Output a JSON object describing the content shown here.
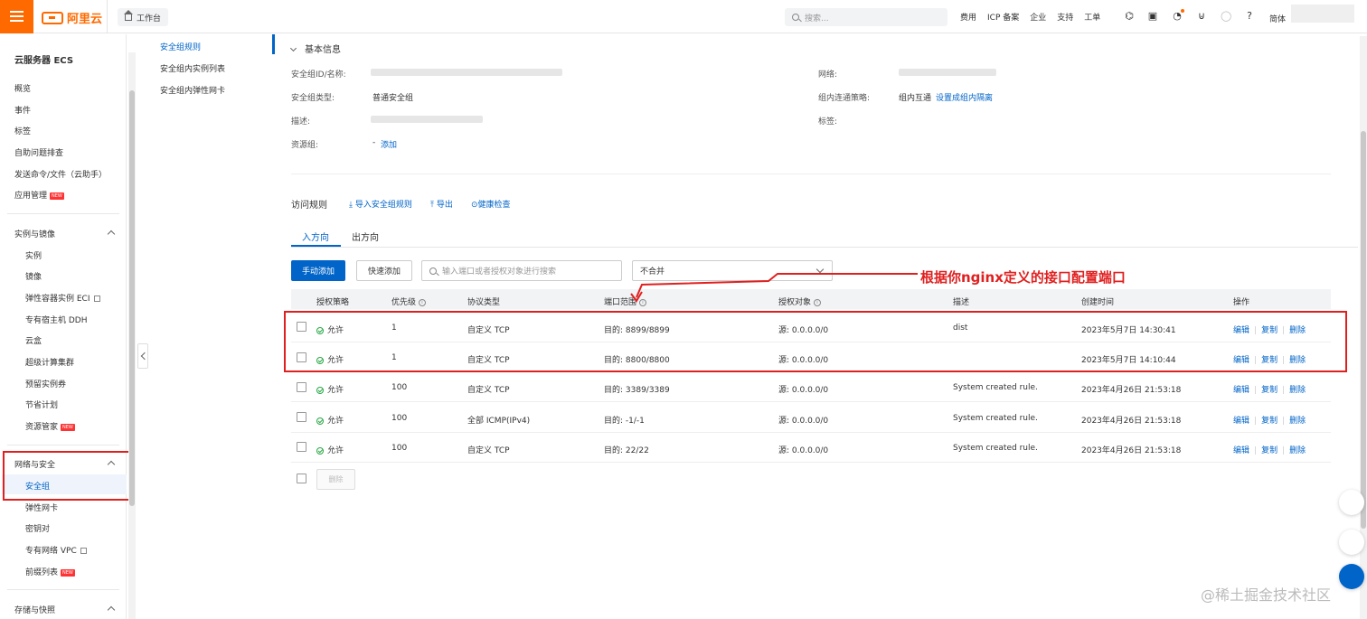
{
  "header": {
    "brand": "阿里云",
    "workbench": "工作台",
    "search_placeholder": "搜索...",
    "links": [
      "费用",
      "ICP 备案",
      "企业",
      "支持",
      "工单"
    ],
    "user": "简体"
  },
  "sidebar": {
    "title": "云服务器 ECS",
    "top_items": [
      "概览",
      "事件",
      "标签",
      "自助问题排查",
      "发送命令/文件（云助手）",
      "应用管理"
    ],
    "new_badge": "NEW",
    "section_instances": "实例与镜像",
    "instance_items": [
      "实例",
      "镜像",
      "弹性容器实例 ECI",
      "专有宿主机 DDH",
      "云盒",
      "超级计算集群",
      "预留实例券",
      "节省计划",
      "资源管家"
    ],
    "section_network": "网络与安全",
    "network_items": [
      "安全组",
      "弹性网卡",
      "密钥对",
      "专有网络 VPC",
      "前缀列表"
    ],
    "section_storage": "存储与快照"
  },
  "subnav": {
    "items": [
      "安全组规则",
      "安全组内实例列表",
      "安全组内弹性网卡"
    ]
  },
  "basic_info": {
    "title": "基本信息",
    "labels": {
      "id_name": "安全组ID/名称:",
      "type": "安全组类型:",
      "desc": "描述:",
      "resource_group": "资源组:",
      "network": "网络:",
      "policy": "组内连通策略:",
      "tags": "标签:"
    },
    "type_value": "普通安全组",
    "resource_group_dash": "-",
    "resource_group_add": "添加",
    "policy_value": "组内互通",
    "policy_link": "设置成组内隔离"
  },
  "rules": {
    "label": "访问规则",
    "import": "导入安全组规则",
    "export": "导出",
    "health": "健康检查",
    "tabs": [
      "入方向",
      "出方向"
    ],
    "add_manual": "手动添加",
    "add_quick": "快速添加",
    "search_placeholder": "输入端口或者授权对象进行搜索",
    "merge_value": "不合并",
    "columns": [
      "授权策略",
      "优先级",
      "协议类型",
      "端口范围",
      "授权对象",
      "描述",
      "创建时间",
      "操作"
    ],
    "rows": [
      {
        "policy": "允许",
        "priority": "1",
        "protocol": "自定义 TCP",
        "port": "目的: 8899/8899",
        "object": "源: 0.0.0.0/0",
        "desc": "dist",
        "time": "2023年5月7日 14:30:41"
      },
      {
        "policy": "允许",
        "priority": "1",
        "protocol": "自定义 TCP",
        "port": "目的: 8800/8800",
        "object": "源: 0.0.0.0/0",
        "desc": "",
        "time": "2023年5月7日 14:10:44"
      },
      {
        "policy": "允许",
        "priority": "100",
        "protocol": "自定义 TCP",
        "port": "目的: 3389/3389",
        "object": "源: 0.0.0.0/0",
        "desc": "System created rule.",
        "time": "2023年4月26日 21:53:18"
      },
      {
        "policy": "允许",
        "priority": "100",
        "protocol": "全部 ICMP(IPv4)",
        "port": "目的: -1/-1",
        "object": "源: 0.0.0.0/0",
        "desc": "System created rule.",
        "time": "2023年4月26日 21:53:18"
      },
      {
        "policy": "允许",
        "priority": "100",
        "protocol": "自定义 TCP",
        "port": "目的: 22/22",
        "object": "源: 0.0.0.0/0",
        "desc": "System created rule.",
        "time": "2023年4月26日 21:53:18"
      }
    ],
    "ops": [
      "编辑",
      "复制",
      "删除"
    ],
    "delete_btn": "删除"
  },
  "annotation": "根据你nginx定义的接口配置端口",
  "watermark": "@稀土掘金技术社区",
  "colors": {
    "accent": "#ff6a00",
    "primary": "#0064c8",
    "annotation": "#e02020"
  }
}
